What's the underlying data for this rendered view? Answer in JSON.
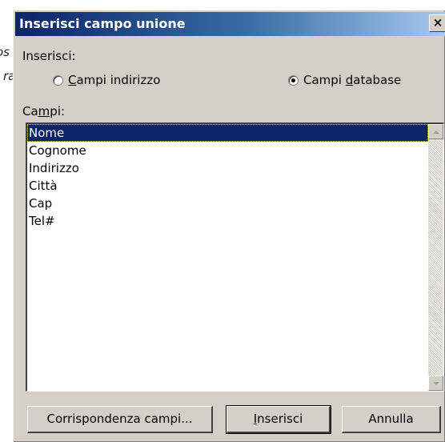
{
  "background": {
    "line1": "os",
    "line2": "ra"
  },
  "dialog": {
    "title": "Inserisci campo unione",
    "close_glyph": "×",
    "insert_section_label": "Inserisci:",
    "radio_address": {
      "pre": "",
      "hotkey": "C",
      "post": "ampi indirizzo",
      "selected": false
    },
    "radio_database": {
      "pre": "Campi ",
      "hotkey": "d",
      "post": "atabase",
      "selected": true
    },
    "fields_label": {
      "pre": "Ca",
      "hotkey": "m",
      "post": "pi:"
    },
    "fields": [
      "Nome",
      "Cognome",
      "Indirizzo",
      "Città",
      "Cap",
      "Tel#"
    ],
    "selected_field": "Nome",
    "buttons": {
      "match_fields": {
        "pre": "Corrispondenza campi...",
        "hotkey": "",
        "post": ""
      },
      "insert": {
        "pre": "",
        "hotkey": "I",
        "post": "nserisci"
      },
      "cancel": "Annulla"
    }
  },
  "colors": {
    "dialog_face": "#d4d0c8",
    "titlebar_start": "#0a246a",
    "titlebar_end": "#a6caf0",
    "selection": "#0a246a"
  }
}
